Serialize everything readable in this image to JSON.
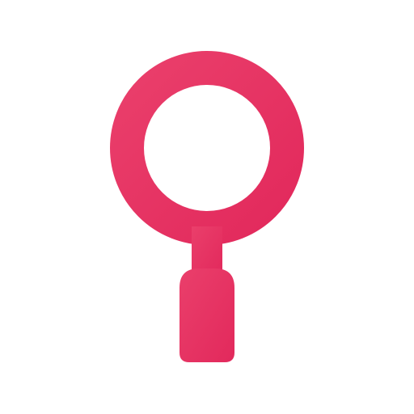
{
  "icon": {
    "name": "magnifier-icon",
    "colors": {
      "background": "#ffffff",
      "gradient_start": "#ea3f6b",
      "gradient_end": "#e2295c"
    }
  }
}
